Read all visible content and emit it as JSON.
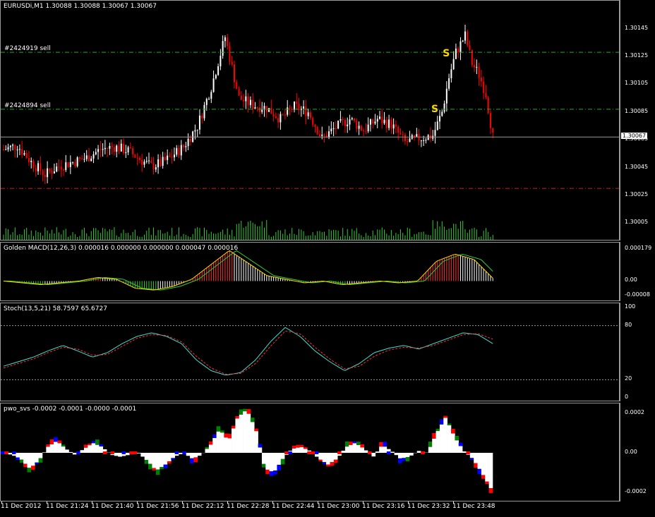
{
  "chart_data": [
    {
      "type": "candlestick",
      "title": "EURUSDi,M1  1.30088 1.30088 1.30067 1.30067",
      "ylim": [
        1.29995,
        1.30155
      ],
      "y_ticks": [
        "1.30145",
        "1.30125",
        "1.30105",
        "1.30085",
        "1.30065",
        "1.30045",
        "1.30025",
        "1.30005"
      ],
      "current_price": "1.30067",
      "order_lines": [
        {
          "label": "#2424919 sell",
          "price": 1.30128
        },
        {
          "label": "#2424894 sell",
          "price": 1.30087
        },
        {
          "label": "",
          "price": 1.3003
        }
      ],
      "signals": [
        {
          "label": "S",
          "index": 99
        },
        {
          "label": "S",
          "index": 96
        }
      ],
      "close_path": [
        [
          0,
          1.30058
        ],
        [
          6,
          1.30061
        ],
        [
          12,
          1.30049
        ],
        [
          18,
          1.3004
        ],
        [
          24,
          1.30046
        ],
        [
          30,
          1.30049
        ],
        [
          36,
          1.30052
        ],
        [
          42,
          1.30058
        ],
        [
          48,
          1.3006
        ],
        [
          54,
          1.30057
        ],
        [
          60,
          1.3005
        ],
        [
          64,
          1.30046
        ],
        [
          68,
          1.30048
        ],
        [
          72,
          1.30052
        ],
        [
          78,
          1.3006
        ],
        [
          84,
          1.30075
        ],
        [
          90,
          1.30103
        ],
        [
          96,
          1.30139
        ],
        [
          102,
          1.30095
        ],
        [
          108,
          1.3009
        ],
        [
          114,
          1.30088
        ],
        [
          120,
          1.3008
        ],
        [
          126,
          1.30089
        ],
        [
          132,
          1.30085
        ],
        [
          138,
          1.30066
        ],
        [
          144,
          1.30074
        ],
        [
          150,
          1.3008
        ],
        [
          156,
          1.30072
        ],
        [
          162,
          1.3008
        ],
        [
          168,
          1.30076
        ],
        [
          174,
          1.30063
        ],
        [
          180,
          1.30066
        ],
        [
          186,
          1.30068
        ],
        [
          190,
          1.30085
        ],
        [
          193,
          1.3011
        ],
        [
          196,
          1.30128
        ],
        [
          200,
          1.3014
        ],
        [
          203,
          1.3012
        ],
        [
          206,
          1.30112
        ],
        [
          209,
          1.30098
        ],
        [
          212,
          1.30067
        ]
      ],
      "volume_scale_max": 30
    },
    {
      "type": "line",
      "title": "Golden MACD(12,26,3) 0.000016 0.000000 0.000000 0.000047 0.000016",
      "y_ticks": [
        "0.000179",
        "0.00",
        "-0.00008"
      ],
      "ylim": [
        -0.0001,
        0.00019
      ],
      "series": [
        {
          "name": "",
          "values": [
            0.0,
            -1e-05,
            -2e-05,
            -1e-05,
            0.0,
            2e-05,
            1e-05,
            -4e-05,
            -5e-05,
            -3e-05,
            1e-05,
            9e-05,
            0.00017,
            0.0001,
            3e-05,
            1e-05,
            -1e-05,
            0.0,
            -2e-05,
            -1e-05,
            0.0,
            -1e-05,
            0.0,
            0.00011,
            0.00015,
            0.00012,
            1.6e-05
          ]
        }
      ]
    },
    {
      "type": "line",
      "title": "Stoch(13,5,21) 58.7597 65.6727",
      "y_ticks": [
        "100",
        "80",
        "20",
        "0"
      ],
      "ylim": [
        0,
        100
      ],
      "levels": [
        80,
        20
      ],
      "series": [
        {
          "name": "",
          "values": [
            35,
            40,
            45,
            52,
            58,
            52,
            45,
            50,
            60,
            68,
            72,
            68,
            60,
            42,
            30,
            25,
            28,
            42,
            62,
            78,
            68,
            52,
            40,
            30,
            38,
            50,
            55,
            58,
            54,
            60,
            66,
            72,
            70,
            60
          ]
        },
        {
          "name": "",
          "values": [
            33,
            38,
            43,
            50,
            56,
            54,
            47,
            48,
            57,
            66,
            70,
            69,
            62,
            46,
            33,
            26,
            27,
            38,
            57,
            74,
            71,
            56,
            43,
            32,
            35,
            46,
            53,
            56,
            55,
            58,
            64,
            70,
            71,
            65
          ]
        }
      ]
    },
    {
      "type": "bar",
      "title": "pwo_svs -0.0002 -0.0001 -0.0000 -0.0001",
      "y_ticks": [
        "0.0002",
        "0.00",
        "-0.0002"
      ],
      "ylim": [
        -0.00023,
        0.00023
      ],
      "series": [
        {
          "name": "",
          "values": [
            0.0,
            -1e-05,
            -3e-05,
            -8e-05,
            -4e-05,
            3e-05,
            6e-05,
            2e-05,
            -1e-05,
            2e-05,
            5e-05,
            3e-05,
            -1e-05,
            -2e-05,
            -1e-05,
            0.0,
            -4e-05,
            -9e-05,
            -6e-05,
            -2e-05,
            0.0,
            -3e-05,
            -1e-05,
            4e-05,
            0.00012,
            6e-05,
            0.00018,
            0.00022,
            0.00012,
            -8e-05,
            -0.0001,
            -3e-05,
            2e-05,
            3e-05,
            1e-05,
            -3e-05,
            -6e-05,
            -3e-05,
            3e-05,
            5e-05,
            2e-05,
            -2e-05,
            4e-05,
            1e-05,
            -3e-05,
            -2e-05,
            1e-05,
            0.0,
            0.0001,
            0.00018,
            8e-05,
            1e-05,
            -3e-05,
            -0.0001,
            -0.00018
          ]
        }
      ]
    }
  ],
  "time_axis": [
    "11 Dec 2012",
    "11 Dec 21:24",
    "11 Dec 21:40",
    "11 Dec 21:56",
    "11 Dec 22:12",
    "11 Dec 22:28",
    "11 Dec 22:44",
    "11 Dec 23:00",
    "11 Dec 23:16",
    "11 Dec 23:32",
    "11 Dec 23:48"
  ],
  "colors": {
    "background": "#000000",
    "bull": "#ffffff",
    "bear": "#ff0000",
    "volume": "#32cd32",
    "grid": "#9a9a9a",
    "order_line": "#22aa22",
    "stop_line": "#cc2222",
    "signal": "#ffd700",
    "macd_line": "#ffd700",
    "macd_signal": "#32cd32",
    "stoch_main": "#40e0d0",
    "stoch_signal": "#ff3030",
    "pwo_pos": "#ffffff",
    "pwo_red": "#ff0000",
    "pwo_blue": "#0000ff",
    "pwo_green": "#008000"
  }
}
